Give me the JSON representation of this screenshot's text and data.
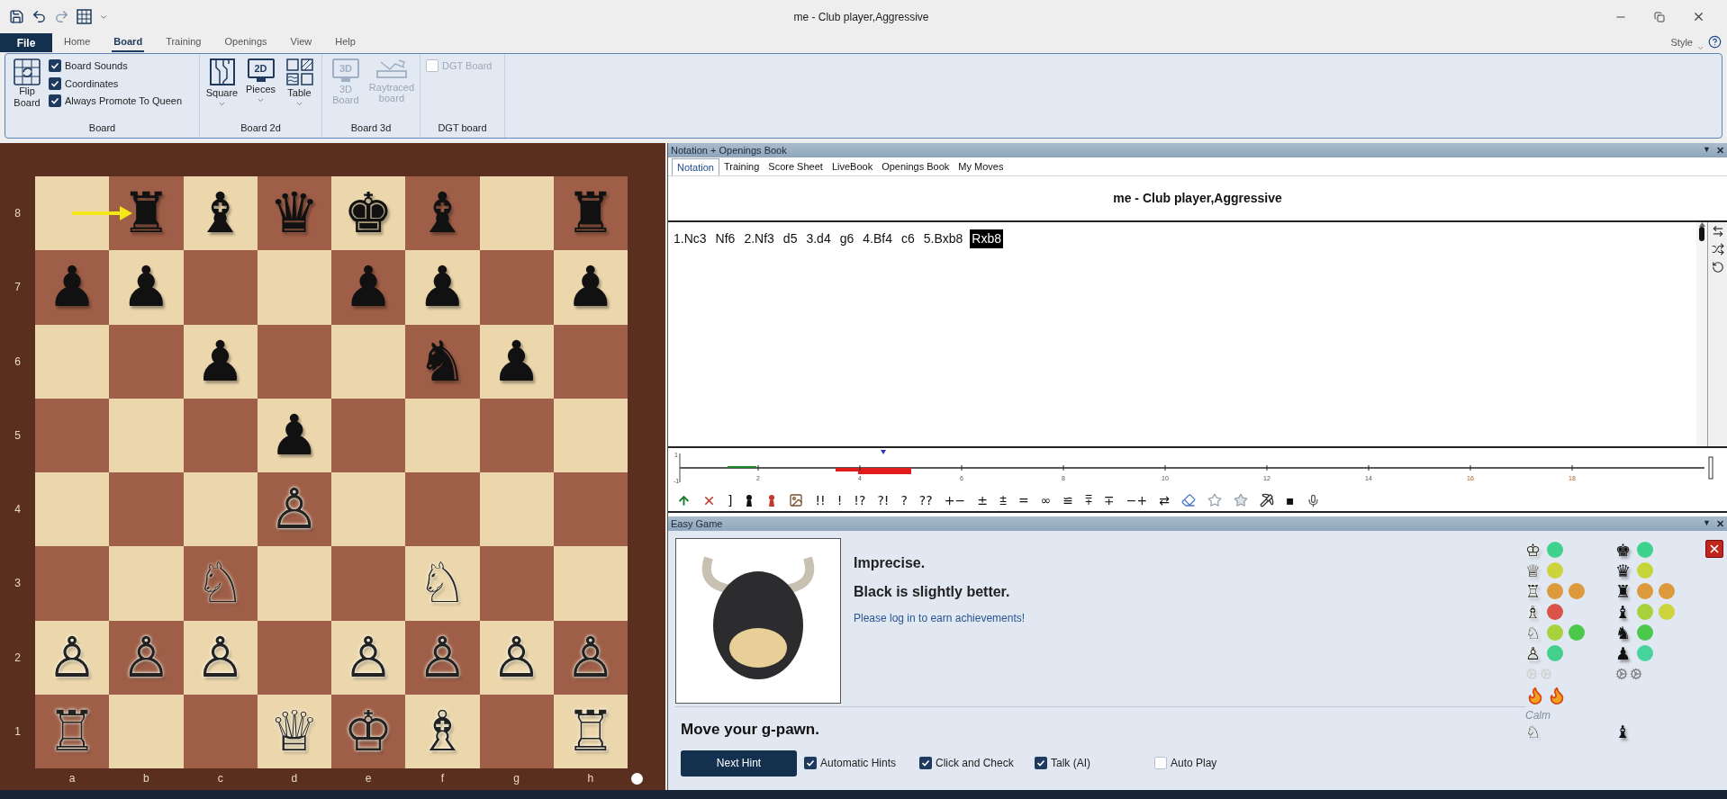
{
  "window": {
    "title": "me - Club player,Aggressive"
  },
  "ribbon_tabs": [
    {
      "label": "File",
      "kind": "file",
      "selected": false
    },
    {
      "label": "Home",
      "kind": "tab",
      "selected": false
    },
    {
      "label": "Board",
      "kind": "tab",
      "selected": true
    },
    {
      "label": "Training",
      "kind": "tab",
      "selected": false
    },
    {
      "label": "Openings",
      "kind": "tab",
      "selected": false
    },
    {
      "label": "View",
      "kind": "tab",
      "selected": false
    },
    {
      "label": "Help",
      "kind": "tab",
      "selected": false
    }
  ],
  "style_menu": {
    "label": "Style"
  },
  "ribbon_groups": [
    {
      "label": "Board",
      "flip_button": {
        "label": "Flip Board"
      },
      "checkboxes": [
        {
          "label": "Board Sounds",
          "checked": true,
          "disabled": false
        },
        {
          "label": "Coordinates",
          "checked": true,
          "disabled": false
        },
        {
          "label": "Always Promote To Queen",
          "checked": true,
          "disabled": false
        }
      ]
    },
    {
      "label": "Board 2d",
      "buttons": [
        {
          "label": "Square",
          "kind": "wood",
          "disabled": false,
          "dropdown": true
        },
        {
          "label": "Pieces",
          "kind": "monitor",
          "icon_text": "2D",
          "disabled": false,
          "dropdown": true
        },
        {
          "label": "Table",
          "kind": "patterns",
          "disabled": false,
          "dropdown": true
        }
      ]
    },
    {
      "label": "Board 3d",
      "buttons": [
        {
          "label": "3D Board",
          "kind": "monitor",
          "icon_text": "3D",
          "disabled": true,
          "dropdown": false
        },
        {
          "label": "Raytraced board",
          "kind": "rays",
          "disabled": true,
          "dropdown": false
        }
      ]
    },
    {
      "label": "DGT board",
      "checkboxes": [
        {
          "label": "DGT Board",
          "checked": false,
          "disabled": true
        }
      ]
    }
  ],
  "board": {
    "files": [
      "a",
      "b",
      "c",
      "d",
      "e",
      "f",
      "g",
      "h"
    ],
    "white_to_move": true,
    "ranks": [
      {
        "label": "8",
        "squares": [
          {
            "arrow_from": true,
            "arrow_to": false
          },
          {
            "piece": "♜",
            "white": false,
            "arrow_from": false,
            "arrow_to": true
          },
          {
            "piece": "♝",
            "white": false,
            "arrow_from": false,
            "arrow_to": false
          },
          {
            "piece": "♛",
            "white": false,
            "arrow_from": false,
            "arrow_to": false
          },
          {
            "piece": "♚",
            "white": false,
            "arrow_from": false,
            "arrow_to": false
          },
          {
            "piece": "♝",
            "white": false,
            "arrow_from": false,
            "arrow_to": false
          },
          {
            "arrow_from": false,
            "arrow_to": false
          },
          {
            "piece": "♜",
            "white": false,
            "arrow_from": false,
            "arrow_to": false
          }
        ]
      },
      {
        "label": "7",
        "squares": [
          {
            "piece": "♟",
            "white": false,
            "arrow_from": false,
            "arrow_to": false
          },
          {
            "piece": "♟",
            "white": false,
            "arrow_from": false,
            "arrow_to": false
          },
          {
            "arrow_from": false,
            "arrow_to": false
          },
          {
            "arrow_from": false,
            "arrow_to": false
          },
          {
            "piece": "♟",
            "white": false,
            "arrow_from": false,
            "arrow_to": false
          },
          {
            "piece": "♟",
            "white": false,
            "arrow_from": false,
            "arrow_to": false
          },
          {
            "arrow_from": false,
            "arrow_to": false
          },
          {
            "piece": "♟",
            "white": false,
            "arrow_from": false,
            "arrow_to": false
          }
        ]
      },
      {
        "label": "6",
        "squares": [
          {
            "arrow_from": false,
            "arrow_to": false
          },
          {
            "arrow_from": false,
            "arrow_to": false
          },
          {
            "piece": "♟",
            "white": false,
            "arrow_from": false,
            "arrow_to": false
          },
          {
            "arrow_from": false,
            "arrow_to": false
          },
          {
            "arrow_from": false,
            "arrow_to": false
          },
          {
            "piece": "♞",
            "white": false,
            "arrow_from": false,
            "arrow_to": false
          },
          {
            "piece": "♟",
            "white": false,
            "arrow_from": false,
            "arrow_to": false
          },
          {
            "arrow_from": false,
            "arrow_to": false
          }
        ]
      },
      {
        "label": "5",
        "squares": [
          {
            "arrow_from": false,
            "arrow_to": false
          },
          {
            "arrow_from": false,
            "arrow_to": false
          },
          {
            "arrow_from": false,
            "arrow_to": false
          },
          {
            "piece": "♟",
            "white": false,
            "arrow_from": false,
            "arrow_to": false
          },
          {
            "arrow_from": false,
            "arrow_to": false
          },
          {
            "arrow_from": false,
            "arrow_to": false
          },
          {
            "arrow_from": false,
            "arrow_to": false
          },
          {
            "arrow_from": false,
            "arrow_to": false
          }
        ]
      },
      {
        "label": "4",
        "squares": [
          {
            "arrow_from": false,
            "arrow_to": false
          },
          {
            "arrow_from": false,
            "arrow_to": false
          },
          {
            "arrow_from": false,
            "arrow_to": false
          },
          {
            "piece": "♙",
            "white": true,
            "arrow_from": false,
            "arrow_to": false
          },
          {
            "arrow_from": false,
            "arrow_to": false
          },
          {
            "arrow_from": false,
            "arrow_to": false
          },
          {
            "arrow_from": false,
            "arrow_to": false
          },
          {
            "arrow_from": false,
            "arrow_to": false
          }
        ]
      },
      {
        "label": "3",
        "squares": [
          {
            "arrow_from": false,
            "arrow_to": false
          },
          {
            "arrow_from": false,
            "arrow_to": false
          },
          {
            "piece": "♘",
            "white": true,
            "arrow_from": false,
            "arrow_to": false
          },
          {
            "arrow_from": false,
            "arrow_to": false
          },
          {
            "arrow_from": false,
            "arrow_to": false
          },
          {
            "piece": "♘",
            "white": true,
            "arrow_from": false,
            "arrow_to": false
          },
          {
            "arrow_from": false,
            "arrow_to": false
          },
          {
            "arrow_from": false,
            "arrow_to": false
          }
        ]
      },
      {
        "label": "2",
        "squares": [
          {
            "piece": "♙",
            "white": true,
            "arrow_from": false,
            "arrow_to": false
          },
          {
            "piece": "♙",
            "white": true,
            "arrow_from": false,
            "arrow_to": false
          },
          {
            "piece": "♙",
            "white": true,
            "arrow_from": false,
            "arrow_to": false
          },
          {
            "arrow_from": false,
            "arrow_to": false
          },
          {
            "piece": "♙",
            "white": true,
            "arrow_from": false,
            "arrow_to": false
          },
          {
            "piece": "♙",
            "white": true,
            "arrow_from": false,
            "arrow_to": false
          },
          {
            "piece": "♙",
            "white": true,
            "arrow_from": false,
            "arrow_to": false
          },
          {
            "piece": "♙",
            "white": true,
            "arrow_from": false,
            "arrow_to": false
          }
        ]
      },
      {
        "label": "1",
        "squares": [
          {
            "piece": "♖",
            "white": true,
            "arrow_from": false,
            "arrow_to": false
          },
          {
            "arrow_from": false,
            "arrow_to": false
          },
          {
            "arrow_from": false,
            "arrow_to": false
          },
          {
            "piece": "♕",
            "white": true,
            "arrow_from": false,
            "arrow_to": false
          },
          {
            "piece": "♔",
            "white": true,
            "arrow_from": false,
            "arrow_to": false
          },
          {
            "piece": "♗",
            "white": true,
            "arrow_from": false,
            "arrow_to": false
          },
          {
            "arrow_from": false,
            "arrow_to": false
          },
          {
            "piece": "♖",
            "white": true,
            "arrow_from": false,
            "arrow_to": false
          }
        ]
      }
    ]
  },
  "notation_panel": {
    "title": "Notation + Openings Book",
    "menu_glyph": "▼",
    "close_glyph": "✕",
    "tabs": [
      {
        "label": "Notation",
        "selected": true
      },
      {
        "label": "Training",
        "selected": false
      },
      {
        "label": "Score Sheet",
        "selected": false
      },
      {
        "label": "LiveBook",
        "selected": false
      },
      {
        "label": "Openings Book",
        "selected": false
      },
      {
        "label": "My Moves",
        "selected": false
      }
    ],
    "game_title": "me - Club player,Aggressive",
    "moves": [
      {
        "text": "1.Nc3",
        "selected": false
      },
      {
        "text": "Nf6",
        "selected": false
      },
      {
        "text": "2.Nf3",
        "selected": false
      },
      {
        "text": "d5",
        "selected": false
      },
      {
        "text": "3.d4",
        "selected": false
      },
      {
        "text": "g6",
        "selected": false
      },
      {
        "text": "4.Bf4",
        "selected": false
      },
      {
        "text": "c6",
        "selected": false
      },
      {
        "text": "5.Bxb8",
        "selected": false
      },
      {
        "text": "Rxb8",
        "selected": true
      }
    ],
    "eval_graph": {
      "y_labels": [
        "1",
        "-1"
      ],
      "x_labels": [
        "2",
        "4",
        "6",
        "8",
        "10",
        "12",
        "14",
        "16",
        "18"
      ]
    },
    "toolbar": [
      {
        "kind": "icon"
      },
      {
        "kind": "icon"
      },
      {
        "kind": "text",
        "label": "]"
      },
      {
        "kind": "icon"
      },
      {
        "kind": "icon"
      },
      {
        "kind": "icon"
      },
      {
        "kind": "text",
        "label": "!!"
      },
      {
        "kind": "text",
        "label": "!"
      },
      {
        "kind": "text",
        "label": "!?"
      },
      {
        "kind": "text",
        "label": "?!"
      },
      {
        "kind": "text",
        "label": "?"
      },
      {
        "kind": "text",
        "label": "??"
      },
      {
        "kind": "text",
        "label": "+−"
      },
      {
        "kind": "text",
        "label": "±"
      },
      {
        "kind": "text",
        "label": "⩲"
      },
      {
        "kind": "text",
        "label": "="
      },
      {
        "kind": "text",
        "label": "∞"
      },
      {
        "kind": "text",
        "label": "≌"
      },
      {
        "kind": "text",
        "label": "⩱"
      },
      {
        "kind": "text",
        "label": "∓"
      },
      {
        "kind": "text",
        "label": "−+"
      },
      {
        "kind": "text",
        "label": "⇄"
      },
      {
        "kind": "icon"
      },
      {
        "kind": "icon"
      },
      {
        "kind": "icon"
      },
      {
        "kind": "icon"
      },
      {
        "kind": "text",
        "label": "▪"
      },
      {
        "kind": "icon"
      }
    ]
  },
  "easy_game": {
    "title": "Easy Game",
    "menu_glyph": "▼",
    "close_glyph": "✕",
    "assessment": "Imprecise.",
    "evaluation": "Black is slightly better.",
    "login_link": "Please log in to earn achievements!",
    "hint": "Move your g-pawn.",
    "next_hint_button": "Next Hint",
    "options": [
      {
        "label": "Automatic Hints",
        "checked": true
      },
      {
        "label": "Click and Check",
        "checked": true
      },
      {
        "label": "Talk (AI)",
        "checked": true
      },
      {
        "label": "Auto Play",
        "checked": false
      }
    ],
    "white_pieces": [
      {
        "glyph": "♔",
        "dots": [
          {
            "color": "#3fd28e"
          }
        ]
      },
      {
        "glyph": "♕",
        "dots": [
          {
            "color": "#cdd33a"
          }
        ]
      },
      {
        "glyph": "♖",
        "dots": [
          {
            "color": "#dc9a3c"
          },
          {
            "color": "#dc9a3c"
          }
        ]
      },
      {
        "glyph": "♗",
        "dots": [
          {
            "color": "#d9534a"
          }
        ]
      },
      {
        "glyph": "♘",
        "dots": [
          {
            "color": "#a7d23b"
          },
          {
            "color": "#4cc94c"
          }
        ]
      },
      {
        "glyph": "♙",
        "dots": [
          {
            "color": "#42d08a"
          }
        ]
      }
    ],
    "black_pieces": [
      {
        "glyph": "♚",
        "dots": [
          {
            "color": "#3fd28e"
          }
        ]
      },
      {
        "glyph": "♛",
        "dots": [
          {
            "color": "#c6d63a"
          }
        ]
      },
      {
        "glyph": "♜",
        "dots": [
          {
            "color": "#dc9a3c"
          },
          {
            "color": "#dc9a3c"
          }
        ]
      },
      {
        "glyph": "♝",
        "dots": [
          {
            "color": "#a7d23b"
          },
          {
            "color": "#cdd33a"
          }
        ]
      },
      {
        "glyph": "♞",
        "dots": [
          {
            "color": "#4cc94c"
          }
        ]
      },
      {
        "glyph": "♟",
        "dots": [
          {
            "color": "#46d39c"
          }
        ]
      }
    ],
    "mood": "Calm",
    "white_style_glyph": "♘",
    "black_style_glyph": "♝"
  }
}
